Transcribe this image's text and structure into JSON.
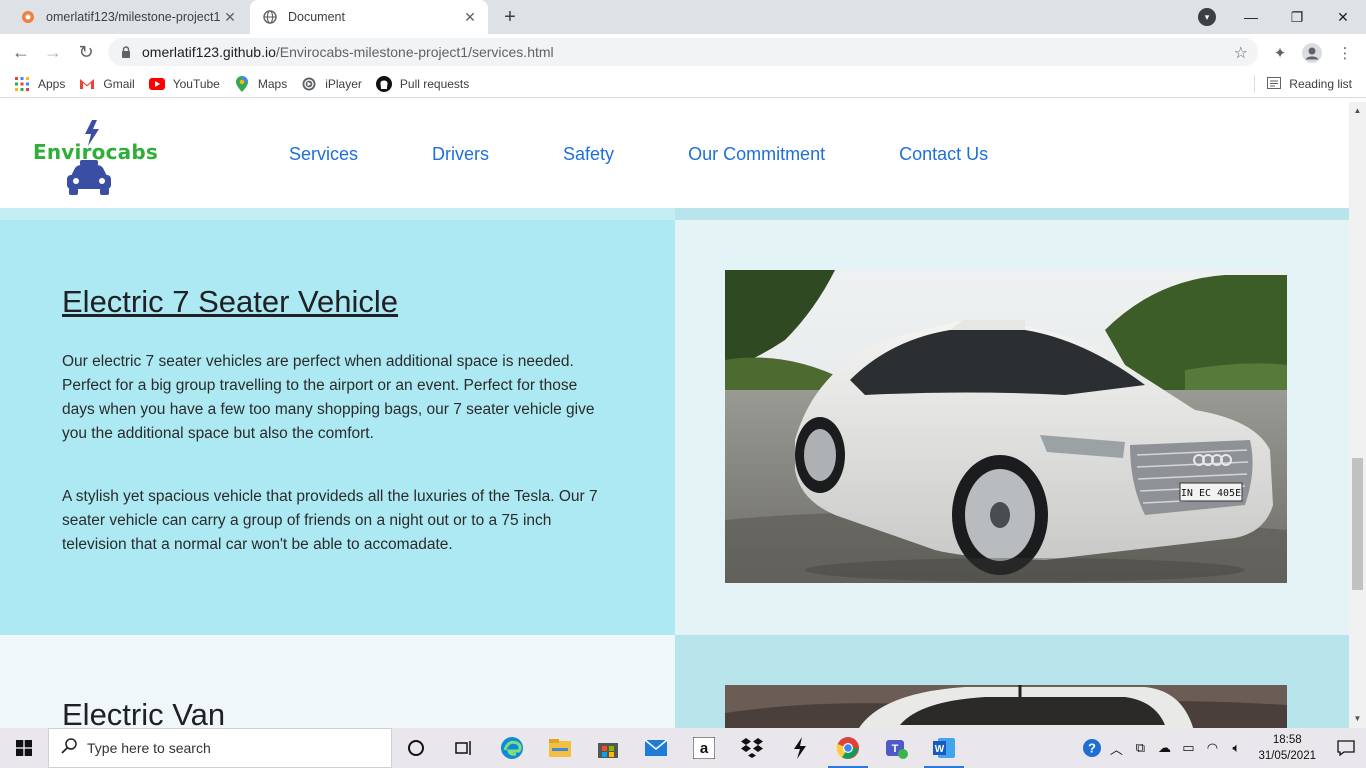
{
  "browser": {
    "tabs": [
      {
        "title": "omerlatif123/milestone-project1",
        "active": false,
        "favicon": "github-orange-icon"
      },
      {
        "title": "Document",
        "active": true,
        "favicon": "globe-icon"
      }
    ],
    "address": {
      "host": "omerlatif123.github.io",
      "path": "/Envirocabs-milestone-project1/services.html"
    },
    "bookmarks": [
      {
        "label": "Apps",
        "icon": "apps-grid-icon"
      },
      {
        "label": "Gmail",
        "icon": "gmail-icon"
      },
      {
        "label": "YouTube",
        "icon": "youtube-icon"
      },
      {
        "label": "Maps",
        "icon": "maps-icon"
      },
      {
        "label": "iPlayer",
        "icon": "iplayer-icon"
      },
      {
        "label": "Pull requests",
        "icon": "github-icon"
      }
    ],
    "reading_list": "Reading list"
  },
  "site": {
    "logo_text": "Envirocabs",
    "nav": [
      "Services",
      "Drivers",
      "Safety",
      "Our Commitment",
      "Contact Us"
    ],
    "section1": {
      "heading": "Electric 7 Seater Vehicle",
      "para1": "Our electric 7 seater vehicles are perfect when additional space is needed. Perfect for a big group travelling to the airport or an event. Perfect for those days when you have a few too many shopping bags, our 7 seater vehicle give you the additional space but also the comfort.",
      "para2": "A stylish yet spacious vehicle that provideds all the luxuries of the Tesla. Our 7 seater vehicle can carry a group of friends on a night out or to a 75 inch television that a normal car won't be able to accomadate.",
      "plate": "IN EC 405E"
    },
    "section2": {
      "heading": "Electric Van"
    }
  },
  "taskbar": {
    "search_placeholder": "Type here to search",
    "time": "18:58",
    "date": "31/05/2021",
    "colors": {
      "accent": "#2b79d8",
      "nav_link": "#1e6fd9",
      "brand_green": "#2fae3a",
      "section_blue": "#ade9f2"
    }
  }
}
